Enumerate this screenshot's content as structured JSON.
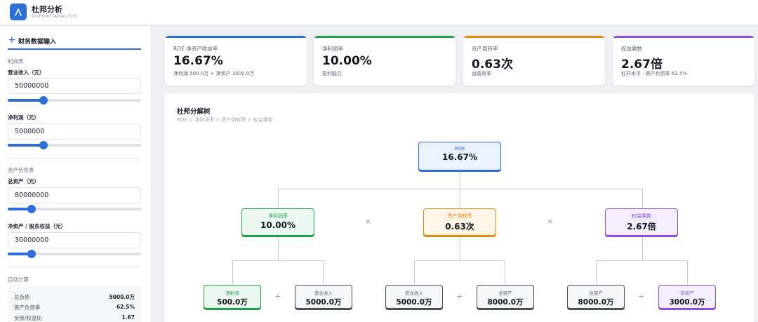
{
  "header": {
    "title": "杜邦分析",
    "subtitle": "DUPONT ANALYSIS",
    "logo_icon": "lambda-icon"
  },
  "sidebar": {
    "title": "财务数据输入",
    "income_section": "利润表",
    "revenue_label": "营业收入（元）",
    "revenue_value": "50000000",
    "revenue_slider": 0.27,
    "net_profit_label": "净利润（元）",
    "net_profit_value": "5000000",
    "net_profit_slider": 0.27,
    "balance_section": "资产负债表",
    "total_assets_label": "总资产（元）",
    "total_assets_value": "80000000",
    "total_assets_slider": 0.18,
    "equity_label": "净资产 / 股东权益（元）",
    "equity_value": "30000000",
    "equity_slider": 0.18,
    "auto_section": "自动计算",
    "calc": [
      {
        "label": "总负债",
        "value": "5000.0万"
      },
      {
        "label": "资产负债率",
        "value": "62.5%"
      },
      {
        "label": "负债/权益比",
        "value": "1.67"
      }
    ]
  },
  "kpis": [
    {
      "label": "ROE 净资产收益率",
      "value": "16.67%",
      "sub": "净利润 500.0万 ÷ 净资产 3000.0万",
      "color": "#2d6fd6"
    },
    {
      "label": "净利润率",
      "value": "10.00%",
      "sub": "盈利能力",
      "color": "#1fa04a"
    },
    {
      "label": "资产周转率",
      "value": "0.63次",
      "sub": "运营效率",
      "color": "#e08a10"
    },
    {
      "label": "权益乘数",
      "value": "2.67倍",
      "sub": "杠杆水平 · 资产负债率 62.5%",
      "color": "#8a4fe0"
    }
  ],
  "tree": {
    "title": "杜邦分解树",
    "formula": "ROE = 净利润率 × 资产周转率 × 权益乘数",
    "root": {
      "label": "ROE",
      "value": "16.67%",
      "color": "#2d6fd6"
    },
    "level2": [
      {
        "label": "净利润率",
        "value": "10.00%",
        "color": "#1fa04a"
      },
      {
        "label": "资产周转率",
        "value": "0.63次",
        "color": "#e08a10"
      },
      {
        "label": "权益乘数",
        "value": "2.67倍",
        "color": "#8a4fe0"
      }
    ],
    "multiply": "×",
    "divide": "÷",
    "leaves": [
      {
        "label": "净利润",
        "value": "500.0万",
        "color": "#1fa04a",
        "label_color": "#1fa04a"
      },
      {
        "label": "营业收入",
        "value": "5000.0万",
        "color": "#4a4f57",
        "label_color": "#5a6270"
      },
      {
        "label": "营业收入",
        "value": "5000.0万",
        "color": "#4a4f57",
        "label_color": "#5a6270"
      },
      {
        "label": "总资产",
        "value": "8000.0万",
        "color": "#4a4f57",
        "label_color": "#5a6270"
      },
      {
        "label": "总资产",
        "value": "8000.0万",
        "color": "#4a4f57",
        "label_color": "#5a6270"
      },
      {
        "label": "净资产",
        "value": "3000.0万",
        "color": "#8a4fe0",
        "label_color": "#8a4fe0"
      }
    ]
  }
}
